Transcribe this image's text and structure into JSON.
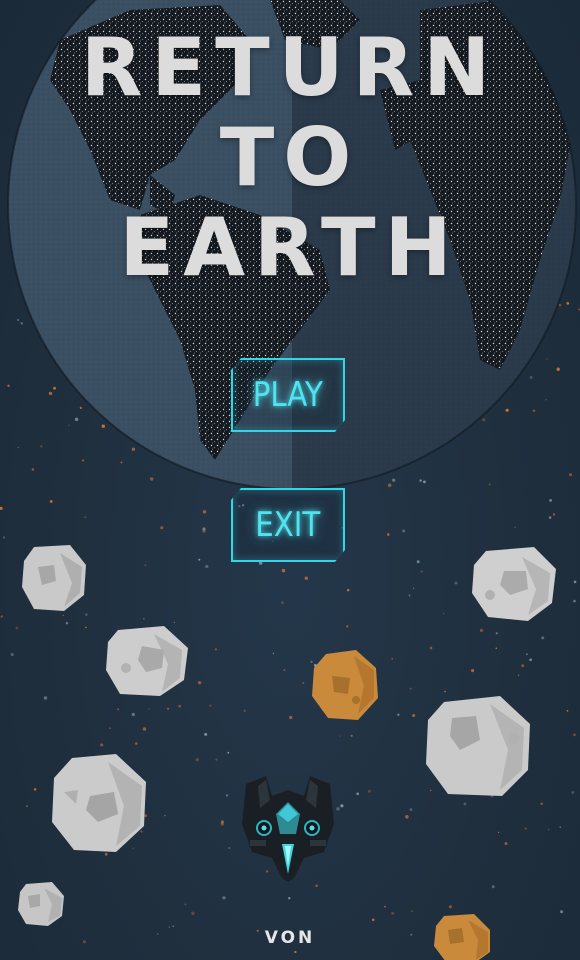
{
  "title": {
    "line1": "RETURN",
    "line2": "TO",
    "line3": "EARTH"
  },
  "menu": {
    "play_label": "PLAY",
    "exit_label": "EXIT"
  },
  "credit": "VON",
  "colors": {
    "background": "#1f2f3e",
    "title_text": "#dcdcdc",
    "button_glow": "#33d6e6",
    "button_text": "#4fe4ef",
    "asteroid_gray": "#c9c9c9",
    "asteroid_orange": "#c98a3b",
    "star_orange": "#d9743a"
  },
  "icons": {
    "globe": "earth-globe-icon",
    "ship": "spaceship-icon",
    "asteroid": "asteroid-icon"
  }
}
